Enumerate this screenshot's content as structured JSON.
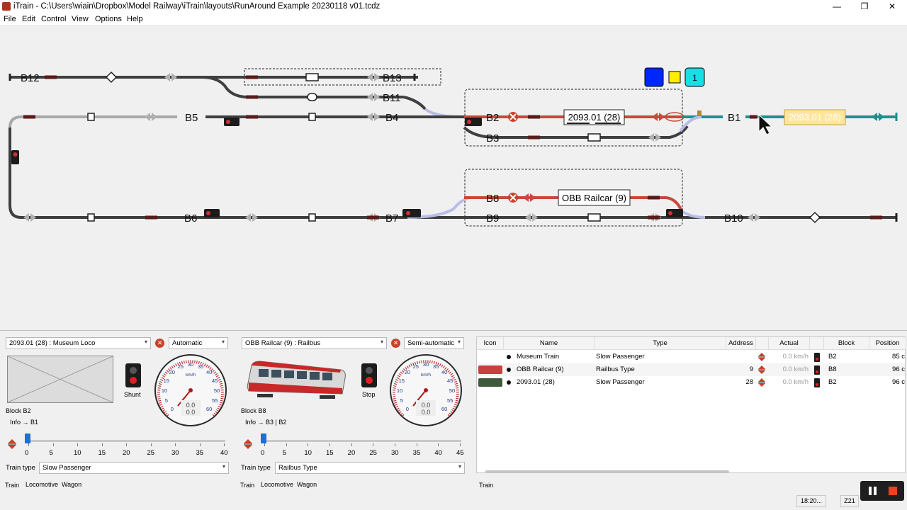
{
  "window": {
    "title": "iTrain - C:\\Users\\wiain\\Dropbox\\Model Railway\\iTrain\\layouts\\RunAround Example 20230118 v01.tcdz",
    "minimize": "—",
    "maximize": "❐",
    "close": "✕"
  },
  "menu": [
    "File",
    "Edit",
    "Control",
    "View",
    "Options",
    "Help"
  ],
  "layout": {
    "blocks": [
      "B12",
      "B13",
      "B11",
      "B5",
      "B4",
      "B2",
      "B3",
      "B1",
      "B8",
      "B9",
      "B6",
      "B7",
      "B10"
    ],
    "train_labels": {
      "b2": "2093.01 (28)",
      "b1": "2093.01 (28)",
      "b8": "OBB Railcar (9)"
    },
    "indicator_number": "1",
    "colors": {
      "occupied": "#c9473c",
      "reserved": "#1f8f8f",
      "track": "#3f3f3f",
      "track_light": "#a8a8a8"
    }
  },
  "control_panels": [
    {
      "train": "2093.01 (28) : Museum Loco",
      "mode": "Automatic",
      "signal_label": "Shunt",
      "block": "Block  B2",
      "info": "Info  → B1",
      "speed_unit": "km/h",
      "speed_actual": "0.0",
      "speed_target": "0.0",
      "dial_ticks": [
        "0",
        "5",
        "10",
        "15",
        "20",
        "25",
        "30",
        "35",
        "40",
        "45",
        "50",
        "55",
        "60"
      ],
      "slider_scale": [
        "0",
        "5",
        "10",
        "15",
        "20",
        "25",
        "30",
        "35",
        "40"
      ],
      "slider_value": 0,
      "train_type_label": "Train type",
      "train_type": "Slow  Passenger",
      "tabs": [
        "Train",
        "Locomotive",
        "Wagon"
      ]
    },
    {
      "train": "OBB Railcar (9) : Railbus",
      "mode": "Semi-automatic",
      "signal_label": "Stop",
      "block": "Block  B8",
      "info": "Info  → B3 | B2",
      "speed_unit": "km/h",
      "speed_actual": "0.0",
      "speed_target": "0.0",
      "dial_ticks": [
        "0",
        "5",
        "10",
        "15",
        "20",
        "25",
        "30",
        "35",
        "40",
        "45",
        "50",
        "55",
        "60"
      ],
      "slider_scale": [
        "0",
        "5",
        "10",
        "15",
        "20",
        "25",
        "30",
        "35",
        "40",
        "45"
      ],
      "slider_value": 0,
      "train_type_label": "Train type",
      "train_type": "Railbus Type",
      "tabs": [
        "Train",
        "Locomotive",
        "Wagon"
      ]
    }
  ],
  "train_table": {
    "headers": [
      "Icon",
      "Name",
      "Type",
      "Address",
      "",
      "Actual",
      "",
      "Block",
      "Position"
    ],
    "rows": [
      {
        "name": "Museum Train",
        "type": "Slow  Passenger",
        "address": "",
        "actual": "0.0 km/h",
        "block": "B2",
        "position": "85 c"
      },
      {
        "name": "OBB Railcar (9)",
        "type": "Railbus Type",
        "address": "9",
        "actual": "0.0 km/h",
        "block": "B8",
        "position": "96 c"
      },
      {
        "name": "2093.01 (28)",
        "type": "Slow  Passenger",
        "address": "28",
        "actual": "0.0 km/h",
        "block": "B2",
        "position": "96 c"
      }
    ],
    "tab": "Train"
  },
  "status": {
    "time": "18:20...",
    "system": "Z21"
  }
}
